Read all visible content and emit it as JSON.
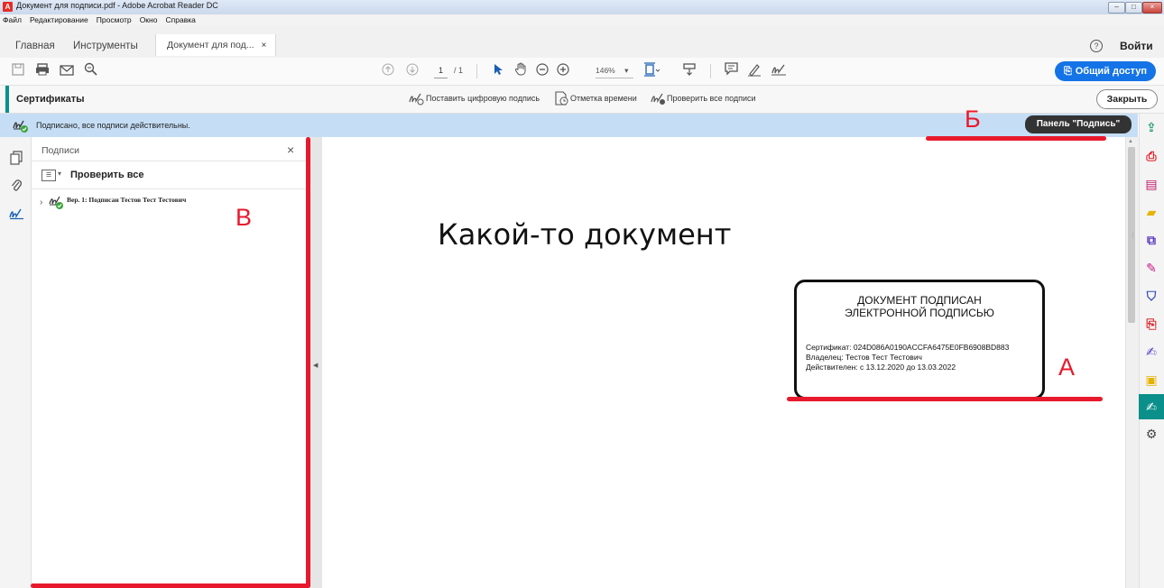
{
  "window": {
    "title": "Документ для подписи.pdf - Adobe Acrobat Reader DC",
    "controls": [
      "–",
      "□",
      "×"
    ]
  },
  "menu": [
    "Файл",
    "Редактирование",
    "Просмотр",
    "Окно",
    "Справка"
  ],
  "tabs": {
    "home": "Главная",
    "tools": "Инструменты",
    "document": "Документ для под...",
    "document_close": "×"
  },
  "account": {
    "help": "?",
    "signin": "Войти"
  },
  "toolbar": {
    "page_current": "1",
    "page_total": "/ 1",
    "zoom": "146%",
    "zoom_caret": "▾",
    "share": "Общий доступ"
  },
  "certificates_bar": {
    "title": "Сертификаты",
    "actions": [
      "Поставить цифровую подпись",
      "Отметка времени",
      "Проверить все подписи"
    ],
    "close": "Закрыть"
  },
  "banner": {
    "text": "Подписано, все подписи действительны.",
    "panel_button": "Панель \"Подпись\""
  },
  "signatures_panel": {
    "title": "Подписи",
    "close": "×",
    "check_all": "Проверить все",
    "items": [
      {
        "label": "Вер. 1: Подписан Тестов Тест Тестович"
      }
    ]
  },
  "document": {
    "heading": "Какой-то документ",
    "stamp": {
      "line1": "ДОКУМЕНТ ПОДПИСАН",
      "line2": "ЭЛЕКТРОННОЙ ПОДПИСЬЮ",
      "certificate": "Сертификат: 024D086A0190ACCFA6475E0FB6908BD883",
      "owner": "Владелец: Тестов Тест Тестович",
      "valid": "Действителен: с 13.12.2020 до 13.03.2022"
    }
  },
  "annotations": {
    "a": "А",
    "b": "Б",
    "v": "В"
  },
  "colors": {
    "accent_teal": "#0a8f8a",
    "share_blue": "#1473e6",
    "banner_blue": "#c5def5",
    "annotation_red": "#e8192c"
  }
}
